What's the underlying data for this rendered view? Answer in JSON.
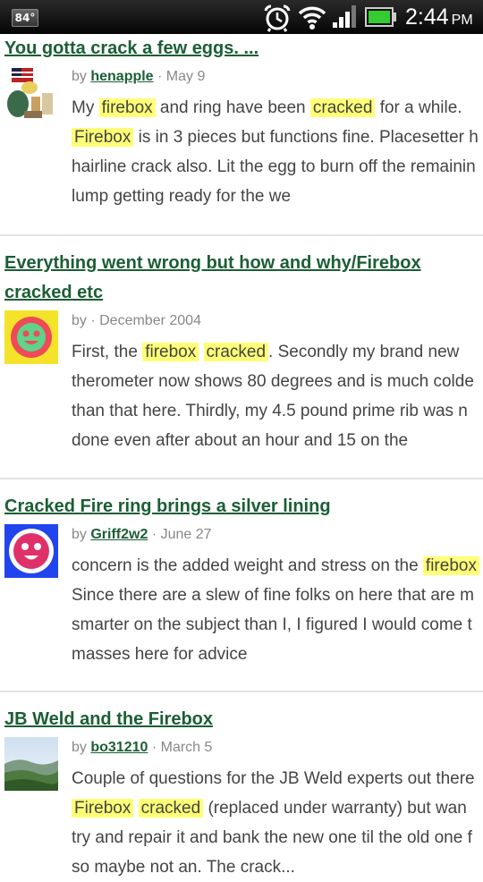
{
  "status_bar": {
    "temperature": "84°",
    "time": "2:44",
    "ampm": "PM",
    "icons": [
      "alarm-clock-icon",
      "wifi-icon",
      "signal-strength-icon",
      "battery-icon"
    ],
    "battery_color": "#33cc33"
  },
  "colors": {
    "link": "#1b5e35",
    "highlight": "#ffff77",
    "text": "#444444",
    "meta": "#888888"
  },
  "results": [
    {
      "title_lines": [
        "You gotta crack a few eggs. ..."
      ],
      "author": "henapple",
      "date": "May 9",
      "snippet_lines": [
        [
          {
            "t": "My "
          },
          {
            "t": "firebox",
            "hl": true
          },
          {
            "t": " and ring have been "
          },
          {
            "t": "cracked",
            "hl": true
          },
          {
            "t": " for a while."
          }
        ],
        [
          {
            "t": "Firebox",
            "hl": true
          },
          {
            "t": " is in 3 pieces but functions fine. Placesetter h"
          }
        ],
        [
          {
            "t": "hairline crack also. Lit the egg to burn off the remainin"
          }
        ],
        [
          {
            "t": "lump getting ready for the we"
          }
        ]
      ]
    },
    {
      "title_lines": [
        "Everything went wrong but how and why/Firebox",
        "cracked etc"
      ],
      "author": "",
      "date": "December 2004",
      "snippet_lines": [
        [
          {
            "t": "First, the "
          },
          {
            "t": "firebox",
            "hl": true
          },
          {
            "t": " "
          },
          {
            "t": "cracked",
            "hl": true
          },
          {
            "t": ". Secondly my brand new"
          }
        ],
        [
          {
            "t": "therometer now shows 80 degrees and is much colde"
          }
        ],
        [
          {
            "t": "than that here. Thirdly, my 4.5 pound prime rib was n"
          }
        ],
        [
          {
            "t": "done even after about an hour and 15 on the"
          }
        ]
      ]
    },
    {
      "title_lines": [
        "Cracked Fire ring brings a silver lining"
      ],
      "author": "Griff2w2",
      "date": "June 27",
      "snippet_lines": [
        [
          {
            "t": "concern is the added weight and stress on the "
          },
          {
            "t": "firebox",
            "hl": true
          }
        ],
        [
          {
            "t": " Since there are a slew of fine folks on here that are m"
          }
        ],
        [
          {
            "t": "smarter on the subject than I, I figured I would come t"
          }
        ],
        [
          {
            "t": "masses here for advice"
          }
        ]
      ]
    },
    {
      "title_lines": [
        "JB Weld and the Firebox"
      ],
      "author": "bo31210",
      "date": "March 5",
      "snippet_lines": [
        [
          {
            "t": "Couple of questions for the JB Weld experts out there"
          }
        ],
        [
          {
            "t": " "
          },
          {
            "t": "Firebox",
            "hl": true
          },
          {
            "t": " "
          },
          {
            "t": "cracked",
            "hl": true
          },
          {
            "t": " (replaced under warranty) but wan"
          }
        ],
        [
          {
            "t": "try and repair it and bank the new one til the old one f"
          }
        ],
        [
          {
            "t": "so maybe not an. The crack..."
          }
        ]
      ]
    }
  ]
}
